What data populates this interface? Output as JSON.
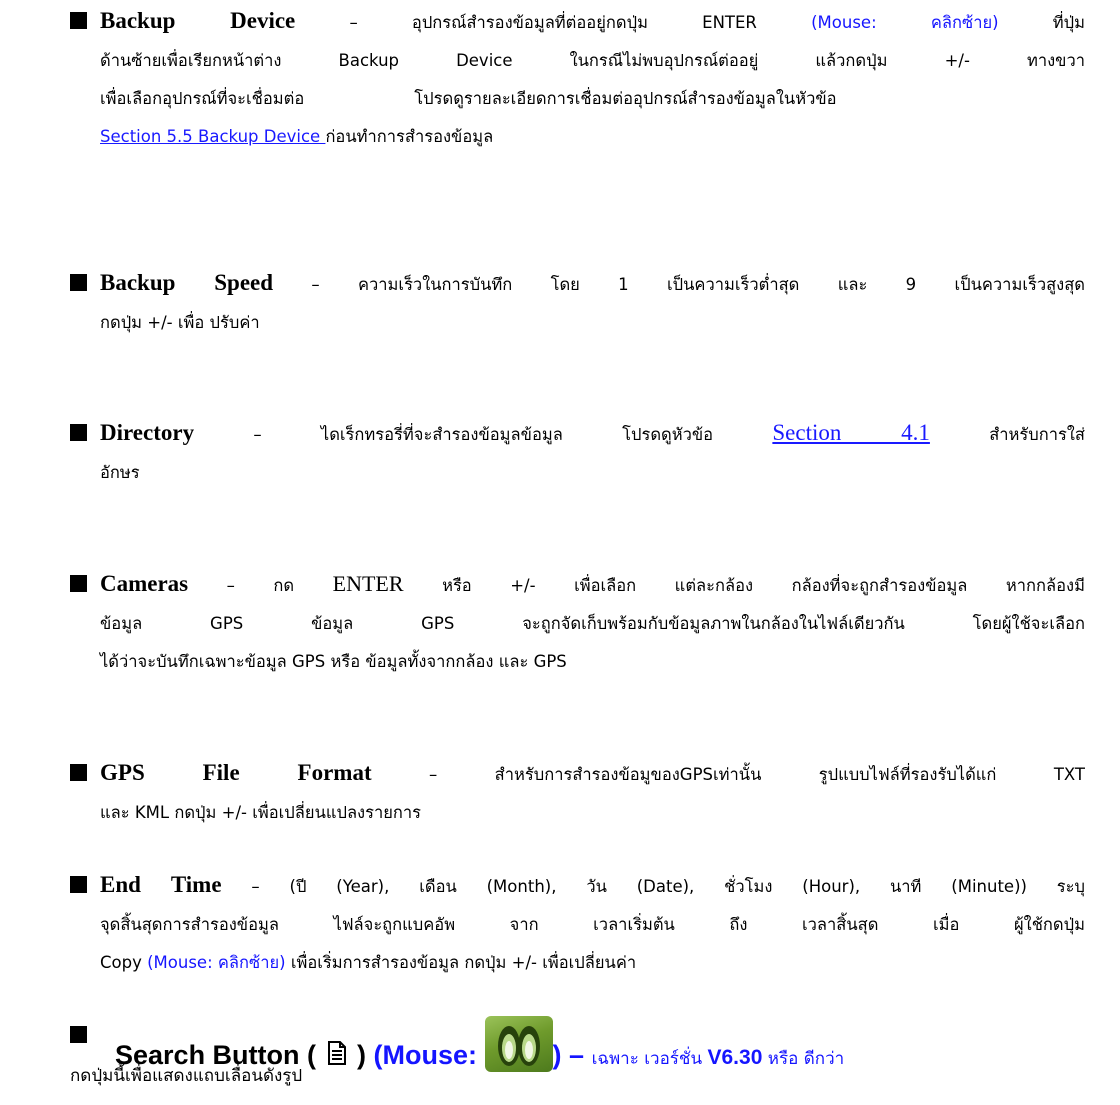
{
  "items": [
    {
      "id": "backup-device",
      "lines": [
        {
          "parts": [
            {
              "t": "Backup Device",
              "c": "head"
            },
            {
              "t": " – อุปกรณ์สำรองข้อมูลที่ต่ออยู่กดปุ่ม "
            },
            {
              "t": "ENTER",
              "c": "b"
            },
            {
              "t": " (Mouse:",
              "c": "b blue"
            },
            {
              "t": " คลิกซ้าย",
              "c": "blue"
            },
            {
              "t": ")",
              "c": "b blue"
            },
            {
              "t": " ที่ปุ่ม"
            }
          ]
        },
        {
          "parts": [
            {
              "t": "ด้านซ้ายเพื่อเรียกหน้าต่าง "
            },
            {
              "t": "Backup Device",
              "c": "b"
            },
            {
              "t": " ในกรณีไม่พบอุปกรณ์ต่ออยู่ แล้วกดปุ่ม "
            },
            {
              "t": "+/-",
              "c": "b"
            },
            {
              "t": " ทางขวา"
            }
          ]
        },
        {
          "parts": [
            {
              "t": "เพื่อเลือกอุปกรณ์ที่จะเชื่อมต่อ"
            },
            {
              "t": "",
              "c": "gap"
            },
            {
              "t": "โปรดดูรายละเอียดการเชื่อมต่ออุปกรณ์สำรองข้อมูลในหัวข้อ"
            }
          ]
        },
        {
          "parts": [
            {
              "t": "Section 5.5 Backup Device ",
              "c": "lnk b"
            },
            {
              "t": "   ก่อนทำการสำรองข้อมูล"
            }
          ]
        }
      ]
    },
    {
      "id": "backup-speed",
      "lines": [
        {
          "parts": [
            {
              "t": "Backup Speed",
              "c": "head"
            },
            {
              "t": " – ความเร็วในการบันทึก โดย 1 เป็นความเร็วต่ำสุด และ 9 เป็นความเร็วสูงสุด"
            }
          ]
        },
        {
          "parts": [
            {
              "t": "กดปุ่ม +/- เพื่อ ปรับค่า"
            }
          ]
        }
      ]
    },
    {
      "id": "directory",
      "lines": [
        {
          "parts": [
            {
              "t": "Directory",
              "c": "head"
            },
            {
              "t": " – ไดเร็กทรอรี่ที่จะสำรองข้อมูลข้อมูล โปรดดูหัวข้อ "
            },
            {
              "t": "Section 4.1",
              "c": "lnk-serif"
            },
            {
              "t": " สำหรับการใส่"
            }
          ]
        },
        {
          "parts": [
            {
              "t": "อักษร"
            }
          ]
        }
      ]
    },
    {
      "id": "cameras",
      "lines": [
        {
          "parts": [
            {
              "t": "Cameras",
              "c": "head"
            },
            {
              "t": " – กด "
            },
            {
              "t": "ENTER",
              "c": "serif"
            },
            {
              "t": " หรือ +/- เพื่อเลือก แต่ละกล้อง กล้องที่จะถูกสำรองข้อมูล หากกล้องมี"
            }
          ]
        },
        {
          "parts": [
            {
              "t": "ข้อมูล "
            },
            {
              "t": "GPS",
              "c": "b"
            },
            {
              "t": " ข้อมูล "
            },
            {
              "t": "GPS",
              "c": "b"
            },
            {
              "t": " จะถูกจัดเก็บพร้อมกับข้อมูลภาพในกล้องในไฟล์เดียวกัน โดยผู้ใช้จะเลือก"
            }
          ]
        },
        {
          "parts": [
            {
              "t": "ได้ว่าจะบันทึกเฉพาะข้อมูล "
            },
            {
              "t": "GPS",
              "c": "b"
            },
            {
              "t": " หรือ ข้อมูลทั้งจากกล้อง และ "
            },
            {
              "t": "GPS",
              "c": "b"
            }
          ]
        }
      ]
    },
    {
      "id": "gps-file-format",
      "lines": [
        {
          "parts": [
            {
              "t": "GPS File Format",
              "c": "head"
            },
            {
              "t": " – สำหรับการสำรองข้อมูของGPSเท่านั้น รูปแบบไฟล์ที่รองรับได้แก่ "
            },
            {
              "t": "TXT",
              "c": "b"
            }
          ]
        },
        {
          "parts": [
            {
              "t": "และ "
            },
            {
              "t": "KML",
              "c": "b"
            },
            {
              "t": " กดปุ่ม "
            },
            {
              "t": "+/-",
              "c": "b"
            },
            {
              "t": " เพื่อเปลี่ยนแปลงรายการ"
            }
          ]
        }
      ]
    },
    {
      "id": "end-time",
      "lines": [
        {
          "parts": [
            {
              "t": "End Time",
              "c": "head"
            },
            {
              "t": " – (ปี "
            },
            {
              "t": "(Year)",
              "c": "b"
            },
            {
              "t": ", เดือน "
            },
            {
              "t": "(Month)",
              "c": "b"
            },
            {
              "t": ", วัน "
            },
            {
              "t": "(Date)",
              "c": "b"
            },
            {
              "t": ", ชั่วโมง "
            },
            {
              "t": "(Hour)",
              "c": "b"
            },
            {
              "t": ", นาที "
            },
            {
              "t": "(Minute)",
              "c": "b"
            },
            {
              "t": ") ระบุ"
            }
          ]
        },
        {
          "parts": [
            {
              "t": "จุดสิ้นสุดการสำรองข้อมูล ไฟล์จะถูกแบคอัพ จาก เวลาเริ่มต้น ถึง เวลาสิ้นสุด เมื่อ ผู้ใช้กดปุ่ม"
            }
          ]
        },
        {
          "parts": [
            {
              "t": "Copy",
              "c": "b"
            },
            {
              "t": " (Mouse:",
              "c": "b blue"
            },
            {
              "t": " คลิกซ้าย",
              "c": "blue"
            },
            {
              "t": ")",
              "c": "b blue"
            },
            {
              "t": " เพื่อเริ่มการสำรองข้อมูล กดปุ่ม +/- เพื่อเปลี่ยนค่า"
            }
          ]
        }
      ]
    }
  ],
  "search": {
    "head_a": "Search Button (",
    "head_b": ")",
    "mouse": " (Mouse: ",
    "dash": ") – ",
    "only": "เฉพาะ เวอร์ชั่น ",
    "version": "V6.30",
    "or_better": " หรือ ดีกว่า",
    "sub": "กดปุ่มนี้เพื่อแสดงแถบเลื่อนดังรูป",
    "icon_doc": "document-icon",
    "icon_mouse": "binoculars-icon"
  },
  "colors": {
    "accent_blue": "#1515ff",
    "link_blue": "#1a1aff",
    "icon_green": "#6f9b2c"
  }
}
